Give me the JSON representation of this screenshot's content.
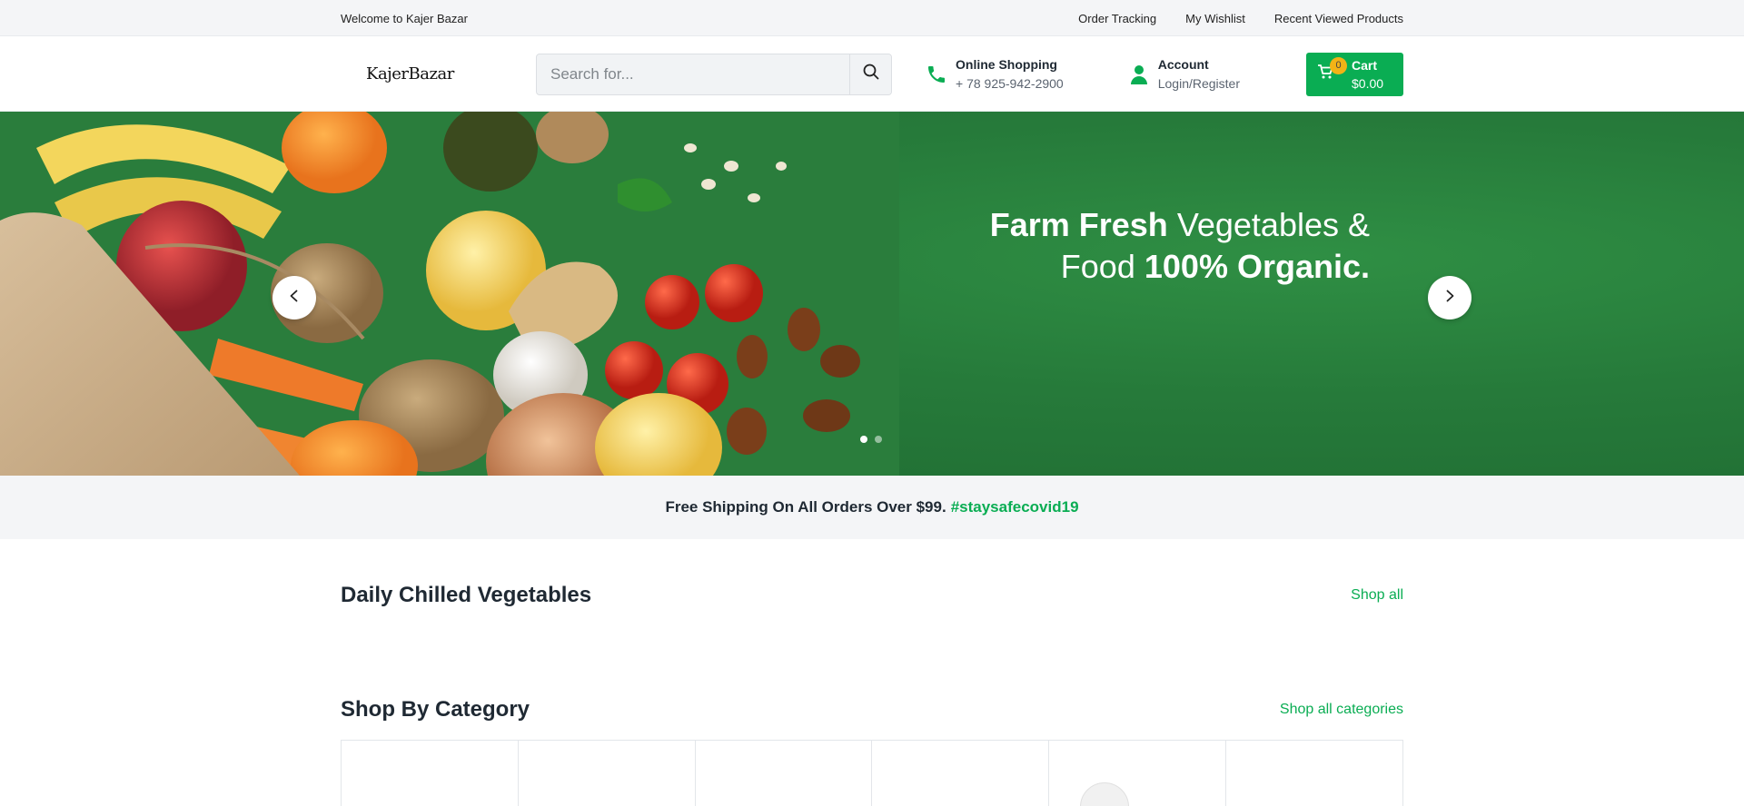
{
  "topbar": {
    "welcome": "Welcome to Kajer Bazar",
    "links": [
      "Order Tracking",
      "My Wishlist",
      "Recent Viewed Products"
    ]
  },
  "header": {
    "logo": "KajerBazar",
    "search_placeholder": "Search for...",
    "contact": {
      "title": "Online Shopping",
      "phone": "+ 78 925-942-2900"
    },
    "account": {
      "title": "Account",
      "subtitle": "Login/Register"
    },
    "cart": {
      "label": "Cart",
      "total": "$0.00",
      "count": "0"
    }
  },
  "hero": {
    "line1_bold": "Farm Fresh",
    "line1_rest": "Vegetables &",
    "line2_regular": "Food",
    "line2_bold": "100% Organic.",
    "slides": 2,
    "active_slide": 1
  },
  "promo": {
    "text": "Free Shipping On All Orders Over $99.",
    "tag": "#staysafecovid19"
  },
  "sections": {
    "vegetables": {
      "title": "Daily Chilled Vegetables",
      "link": "Shop all"
    },
    "category": {
      "title": "Shop By Category",
      "link": "Shop all categories"
    }
  },
  "colors": {
    "accent": "#0aad53",
    "badge": "#f2b316",
    "hero_bg": "#267a3a"
  },
  "icons": [
    "search-icon",
    "phone-icon",
    "user-icon",
    "cart-icon",
    "chevron-left-icon",
    "chevron-right-icon"
  ]
}
